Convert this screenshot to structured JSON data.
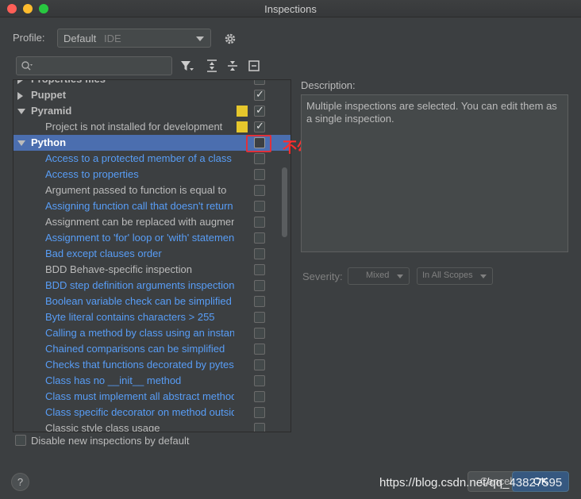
{
  "window": {
    "title": "Inspections"
  },
  "profile": {
    "label": "Profile:",
    "value": "Default",
    "scope": "IDE"
  },
  "search": {
    "placeholder": ""
  },
  "tree": {
    "rows": [
      {
        "kind": "group",
        "label": "Properties files",
        "expanded": false,
        "checked": false,
        "swatch": false
      },
      {
        "kind": "group",
        "label": "Puppet",
        "expanded": false,
        "checked": true,
        "swatch": false
      },
      {
        "kind": "group",
        "label": "Pyramid",
        "expanded": true,
        "checked": true,
        "swatch": true
      },
      {
        "kind": "child",
        "label": "Project is not installed for development",
        "color": "gray",
        "checked": true,
        "swatch": true
      },
      {
        "kind": "group",
        "label": "Python",
        "expanded": true,
        "checked": false,
        "selected": true
      },
      {
        "kind": "child",
        "label": "Access to a protected member of a class",
        "color": "blue",
        "checked": false
      },
      {
        "kind": "child",
        "label": "Access to properties",
        "color": "blue",
        "checked": false
      },
      {
        "kind": "child",
        "label": "Argument passed to function is equal to",
        "color": "gray",
        "checked": false
      },
      {
        "kind": "child",
        "label": "Assigning function call that doesn't return",
        "color": "blue",
        "checked": false
      },
      {
        "kind": "child",
        "label": "Assignment can be replaced with augmented",
        "color": "gray",
        "checked": false
      },
      {
        "kind": "child",
        "label": "Assignment to 'for' loop or 'with' statement",
        "color": "blue",
        "checked": false
      },
      {
        "kind": "child",
        "label": "Bad except clauses order",
        "color": "blue",
        "checked": false
      },
      {
        "kind": "child",
        "label": "BDD Behave-specific inspection",
        "color": "gray",
        "checked": false
      },
      {
        "kind": "child",
        "label": "BDD step definition arguments inspection",
        "color": "blue",
        "checked": false
      },
      {
        "kind": "child",
        "label": "Boolean variable check can be simplified",
        "color": "blue",
        "checked": false
      },
      {
        "kind": "child",
        "label": "Byte literal contains characters > 255",
        "color": "blue",
        "checked": false
      },
      {
        "kind": "child",
        "label": "Calling a method by class using an instance",
        "color": "blue",
        "checked": false
      },
      {
        "kind": "child",
        "label": "Chained comparisons can be simplified",
        "color": "blue",
        "checked": false
      },
      {
        "kind": "child",
        "label": "Checks that functions decorated by pytest",
        "color": "blue",
        "checked": false
      },
      {
        "kind": "child",
        "label": "Class has no __init__ method",
        "color": "blue",
        "checked": false
      },
      {
        "kind": "child",
        "label": "Class must implement all abstract methods",
        "color": "blue",
        "checked": false
      },
      {
        "kind": "child",
        "label": "Class specific decorator on method outside",
        "color": "blue",
        "checked": false
      },
      {
        "kind": "child",
        "label": "Classic style class usage",
        "color": "gray",
        "checked": false
      }
    ]
  },
  "annotation": {
    "text": "不勾选"
  },
  "description": {
    "label": "Description:",
    "text": "Multiple inspections are selected. You can edit them as a single inspection."
  },
  "severity": {
    "label": "Severity:",
    "value": "Mixed",
    "scope": "In All Scopes"
  },
  "footer": {
    "disable_new_label": "Disable new inspections by default",
    "help_label": "?",
    "cancel_label": "Cancel",
    "ok_label": "OK",
    "watermark": "https://blog.csdn.net/qq_43827595"
  },
  "colors": {
    "selection": "#4b6eaf",
    "link_blue": "#589df6",
    "swatch_yellow": "#e6c72c",
    "annotation_red": "#e0313a"
  }
}
